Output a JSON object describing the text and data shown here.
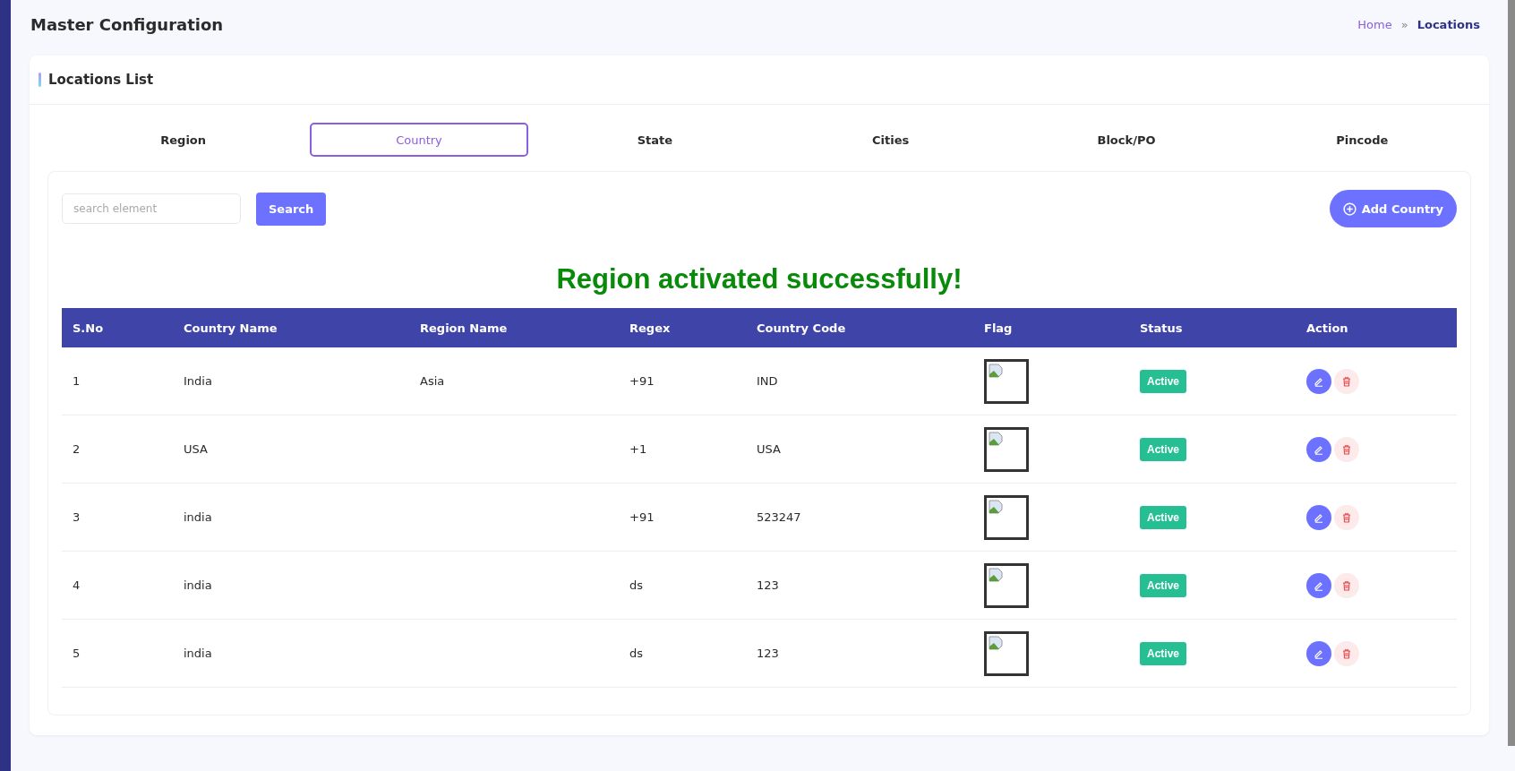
{
  "page_title": "Master Configuration",
  "breadcrumb": {
    "home": "Home",
    "separator": "»",
    "current": "Locations"
  },
  "card_title": "Locations List",
  "tabs": [
    {
      "label": "Region",
      "selected": false
    },
    {
      "label": "Country",
      "selected": true
    },
    {
      "label": "State",
      "selected": false
    },
    {
      "label": "Cities",
      "selected": false
    },
    {
      "label": "Block/PO",
      "selected": false
    },
    {
      "label": "Pincode",
      "selected": false
    }
  ],
  "search": {
    "placeholder": "search element",
    "button": "Search"
  },
  "add_button": "Add Country",
  "message": "Region activated successfully!",
  "table": {
    "columns": [
      "S.No",
      "Country Name",
      "Region Name",
      "Regex",
      "Country Code",
      "Flag",
      "Status",
      "Action"
    ],
    "rows": [
      {
        "sno": "1",
        "country": "India",
        "region": "Asia",
        "regex": "+91",
        "code": "IND",
        "status": "Active"
      },
      {
        "sno": "2",
        "country": "USA",
        "region": "",
        "regex": "+1",
        "code": "USA",
        "status": "Active"
      },
      {
        "sno": "3",
        "country": "india",
        "region": "",
        "regex": "+91",
        "code": "523247",
        "status": "Active"
      },
      {
        "sno": "4",
        "country": "india",
        "region": "",
        "regex": "ds",
        "code": "123",
        "status": "Active"
      },
      {
        "sno": "5",
        "country": "india",
        "region": "",
        "regex": "ds",
        "code": "123",
        "status": "Active"
      }
    ]
  }
}
